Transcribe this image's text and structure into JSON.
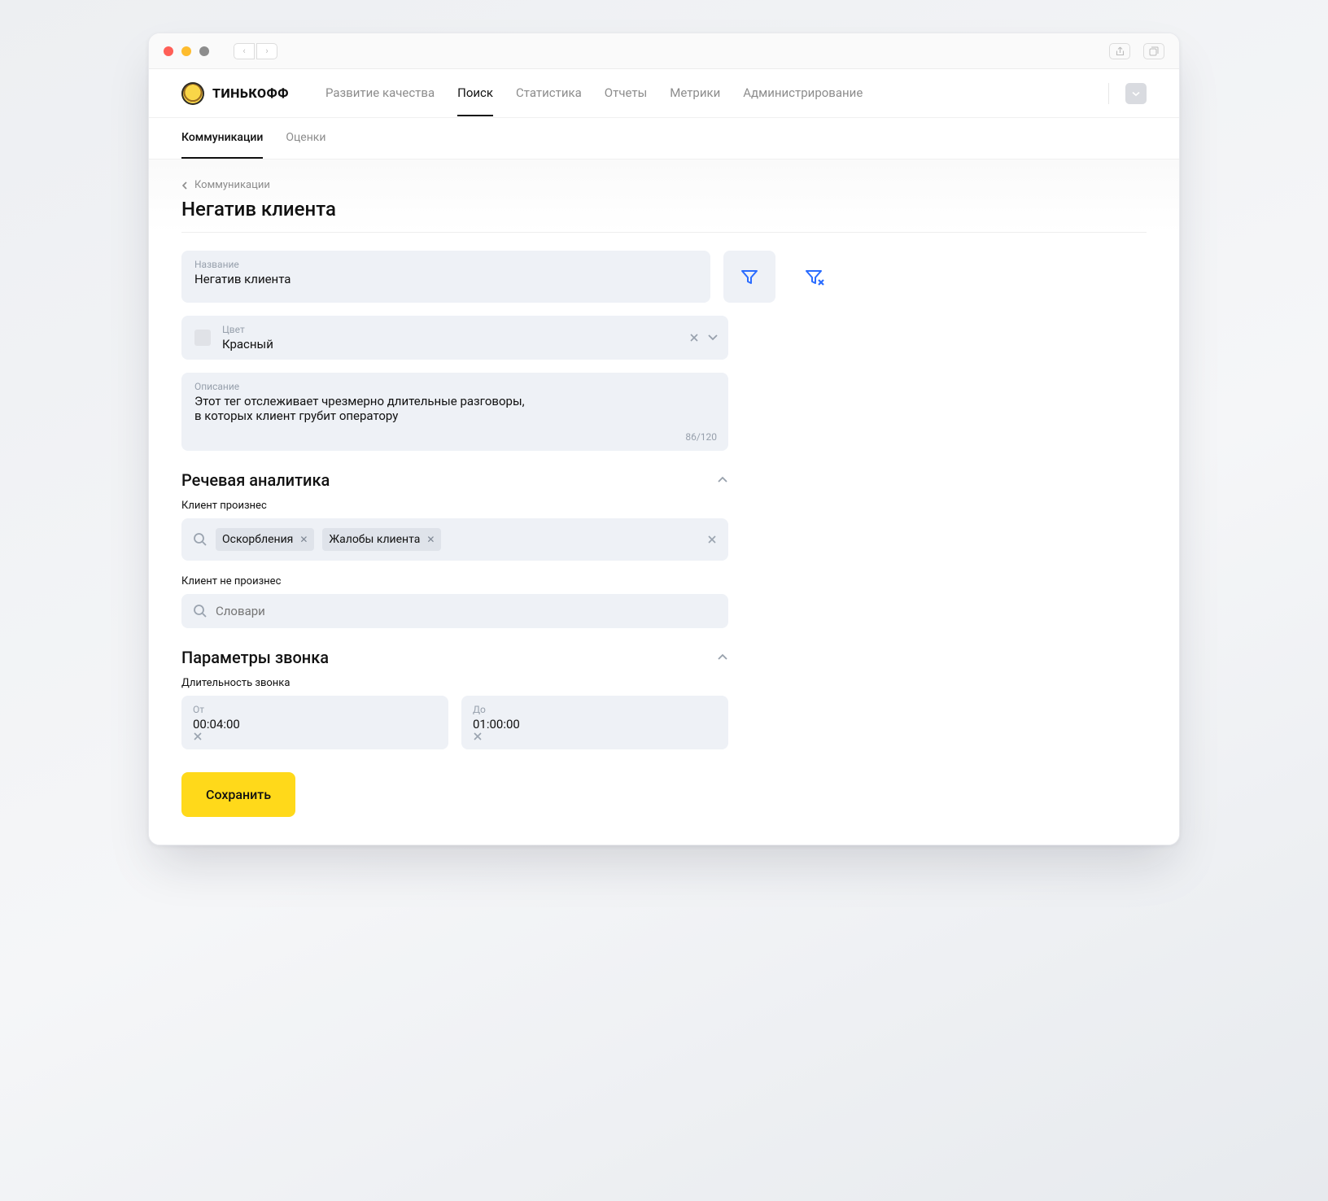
{
  "brand": {
    "name": "ТИНЬКОФФ"
  },
  "topnav": {
    "items": [
      "Развитие качества",
      "Поиск",
      "Статистика",
      "Отчеты",
      "Метрики",
      "Администрирование"
    ],
    "active_index": 1
  },
  "subnav": {
    "items": [
      "Коммуникации",
      "Оценки"
    ],
    "active_index": 0
  },
  "breadcrumb": "Коммуникации",
  "page_title": "Негатив клиента",
  "name_field": {
    "label": "Название",
    "value": "Негатив клиента"
  },
  "color_field": {
    "label": "Цвет",
    "value": "Красный"
  },
  "description_field": {
    "label": "Описание",
    "value_line1": "Этот тег отслеживает чрезмерно длительные разговоры,",
    "value_line2": "в которых клиент грубит оператору",
    "counter": "86/120"
  },
  "speech_section": {
    "title": "Речевая аналитика",
    "spoke_label": "Клиент произнес",
    "spoke_chips": [
      "Оскорбления",
      "Жалобы клиента"
    ],
    "not_spoke_label": "Клиент не произнес",
    "not_spoke_placeholder": "Словари"
  },
  "call_section": {
    "title": "Параметры звонка",
    "duration_label": "Длительность звонка",
    "from_label": "От",
    "from_value": "00:04:00",
    "to_label": "До",
    "to_value": "01:00:00"
  },
  "save_button": "Сохранить"
}
